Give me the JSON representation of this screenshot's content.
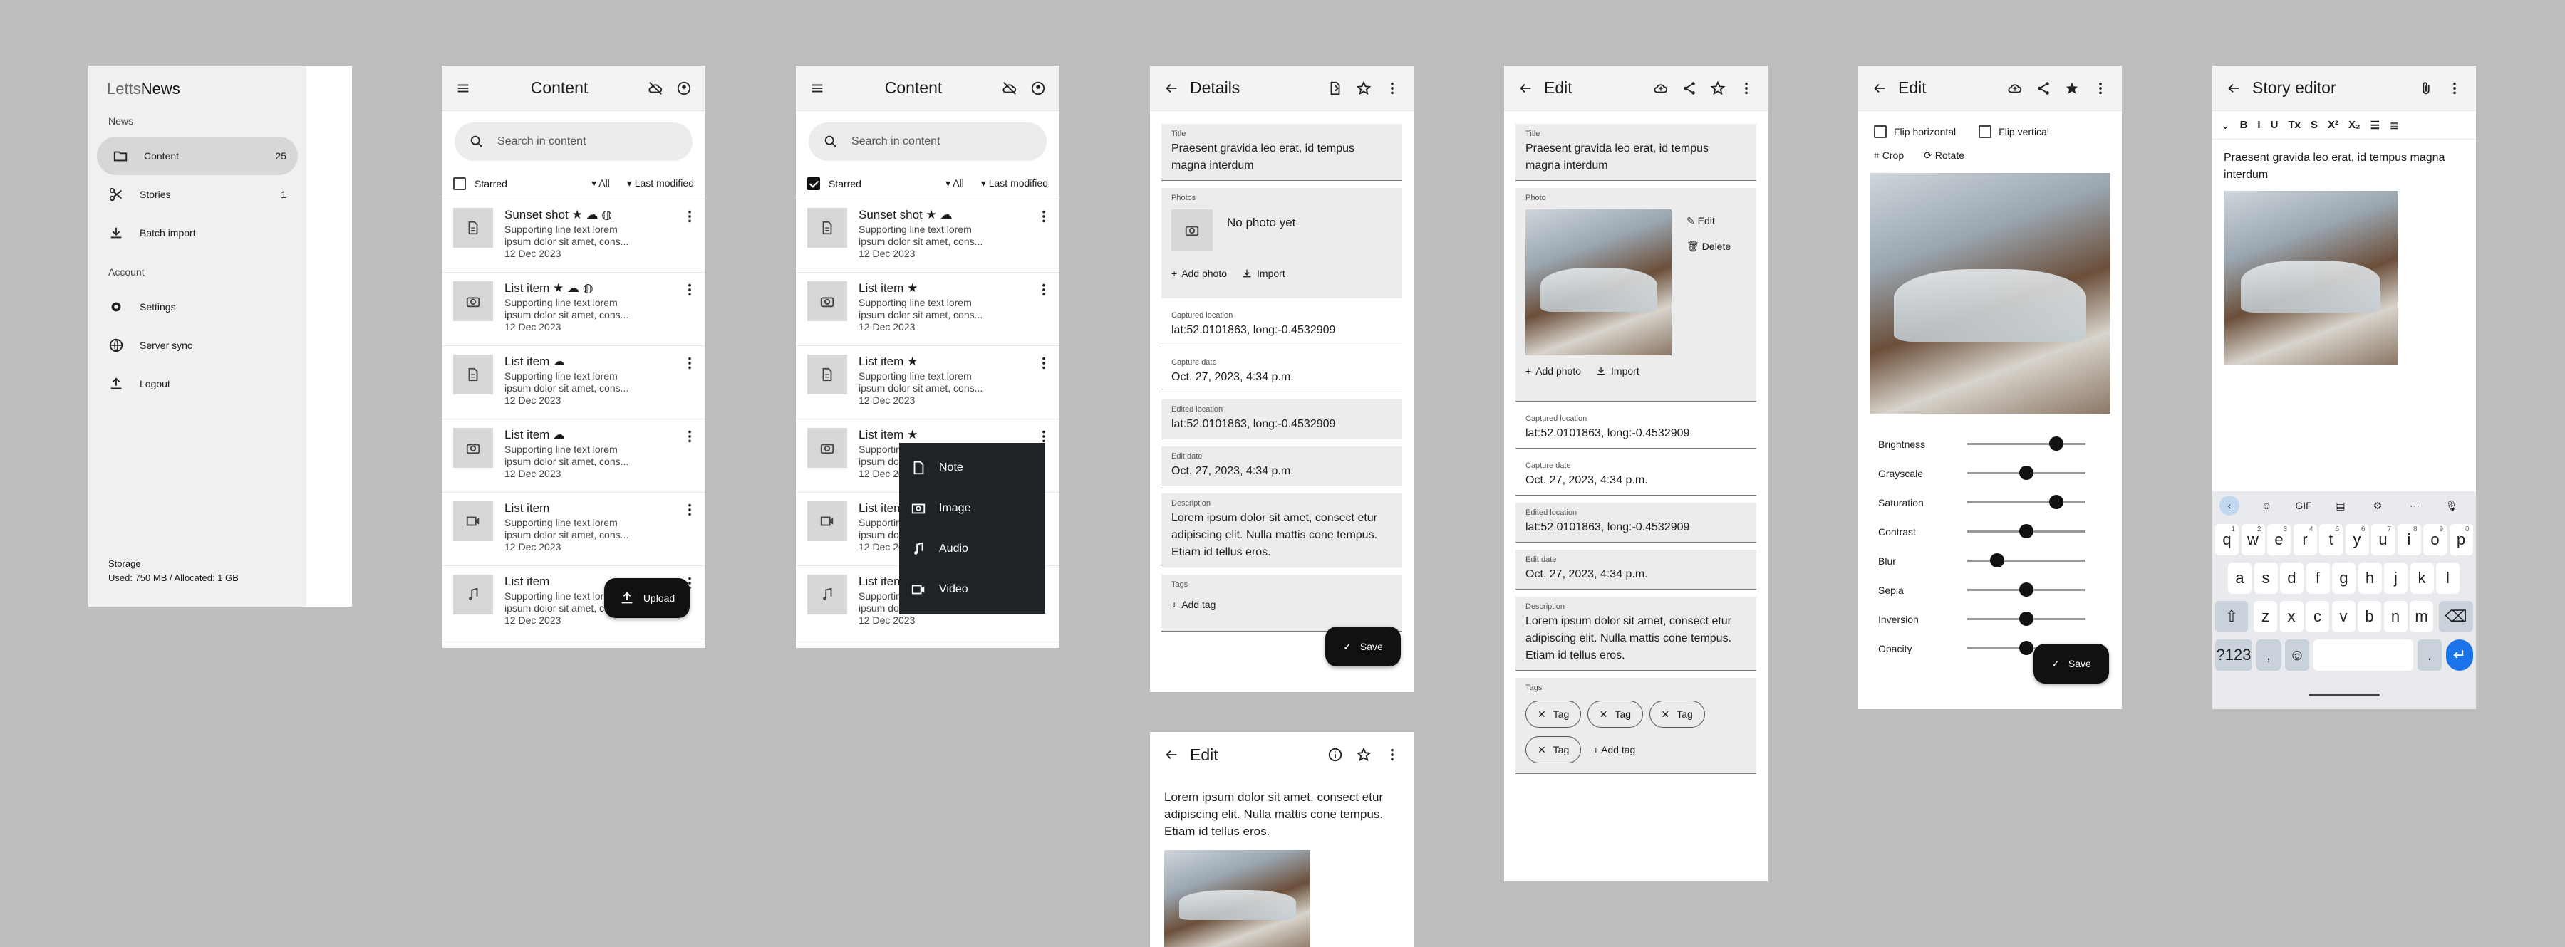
{
  "nav": {
    "brand_a": "Letts",
    "brand_b": "News",
    "section_news": "News",
    "items": [
      {
        "label": "Content",
        "count": "25",
        "icon": "folder-icon"
      },
      {
        "label": "Stories",
        "count": "1",
        "icon": "scissors-icon"
      },
      {
        "label": "Batch import",
        "count": "",
        "icon": "download-icon"
      }
    ],
    "section_account": "Account",
    "account_items": [
      {
        "label": "Settings",
        "icon": "gear-icon"
      },
      {
        "label": "Server sync",
        "icon": "globe-icon"
      },
      {
        "label": "Logout",
        "icon": "logout-icon"
      }
    ],
    "storage_title": "Storage",
    "storage_value": "Used: 750 MB / Allocated: 1 GB"
  },
  "content": {
    "title": "Content",
    "search_placeholder": "Search in content",
    "filter_starred": "Starred",
    "filter_all": "All",
    "filter_sort": "Last modified",
    "upload_label": "Upload",
    "items": [
      {
        "title": "Sunset shot ★ ☁ ◍",
        "l1": "Supporting line text lorem",
        "l2": "ipsum dolor sit amet, cons...",
        "date": "12 Dec 2023",
        "type": "document"
      },
      {
        "title": "List item ★ ☁ ◍",
        "l1": "Supporting line text lorem",
        "l2": "ipsum dolor sit amet, cons...",
        "date": "12 Dec 2023",
        "type": "camera"
      },
      {
        "title": "List item ☁",
        "l1": "Supporting line text lorem",
        "l2": "ipsum dolor sit amet, cons...",
        "date": "12 Dec 2023",
        "type": "document"
      },
      {
        "title": "List item ☁",
        "l1": "Supporting line text lorem",
        "l2": "ipsum dolor sit amet, cons...",
        "date": "12 Dec 2023",
        "type": "camera"
      },
      {
        "title": "List item",
        "l1": "Supporting line text lorem",
        "l2": "ipsum dolor sit amet, cons...",
        "date": "12 Dec 2023",
        "type": "video"
      },
      {
        "title": "List item",
        "l1": "Supporting line text lorem",
        "l2": "ipsum dolor sit amet, cons...",
        "date": "12 Dec 2023",
        "type": "audio"
      }
    ]
  },
  "content2": {
    "items": [
      {
        "title": "Sunset shot ★ ☁"
      },
      {
        "title": "List item ★"
      },
      {
        "title": "List item ★"
      },
      {
        "title": "List item ★"
      },
      {
        "title": "List item"
      },
      {
        "title": "List item"
      }
    ],
    "menu": [
      {
        "label": "Note",
        "icon": "note-icon"
      },
      {
        "label": "Image",
        "icon": "image-icon"
      },
      {
        "label": "Audio",
        "icon": "music-icon"
      },
      {
        "label": "Video",
        "icon": "video-icon"
      }
    ]
  },
  "details": {
    "title": "Details",
    "title_label": "Title",
    "title_value": "Praesent gravida leo erat, id tempus magna interdum",
    "photos_label": "Photos",
    "no_photo": "No photo yet",
    "add_photo": "Add photo",
    "import": "Import",
    "captured_location_label": "Captured location",
    "captured_location": "lat:52.0101863, long:-0.4532909",
    "capture_date_label": "Capture date",
    "capture_date": "Oct. 27, 2023, 4:34 p.m.",
    "edited_location_label": "Edited location",
    "edited_location": "lat:52.0101863, long:-0.4532909",
    "edit_date_label": "Edit date",
    "edit_date": "Oct. 27, 2023, 4:34 p.m.",
    "description_label": "Description",
    "description": "Lorem ipsum dolor sit amet, consect etur adipiscing elit. Nulla mattis cone tempus. Etiam id tellus eros.",
    "tags_label": "Tags",
    "add_tag": "Add tag",
    "save": "Save"
  },
  "edit_small": {
    "title": "Edit",
    "body": "Lorem ipsum dolor sit amet, consect etur adipiscing elit. Nulla mattis cone tempus. Etiam id tellus eros."
  },
  "edit": {
    "title": "Edit",
    "photo_label": "Photo",
    "edit_btn": "Edit",
    "delete_btn": "Delete",
    "tag": "Tag"
  },
  "image_edit": {
    "title": "Edit",
    "flip_h": "Flip horizontal",
    "flip_v": "Flip vertical",
    "crop": "Crop",
    "rotate": "Rotate",
    "sliders": [
      {
        "name": "Brightness",
        "value": 0.75
      },
      {
        "name": "Grayscale",
        "value": 0.5
      },
      {
        "name": "Saturation",
        "value": 0.75
      },
      {
        "name": "Contrast",
        "value": 0.5
      },
      {
        "name": "Blur",
        "value": 0.25
      },
      {
        "name": "Sepia",
        "value": 0.5
      },
      {
        "name": "Inversion",
        "value": 0.5
      },
      {
        "name": "Opacity",
        "value": 0.5
      }
    ],
    "save": "Save"
  },
  "story": {
    "title": "Story editor",
    "text": "Praesent gravida leo erat, id tempus magna interdum",
    "toolbar": [
      "B",
      "I",
      "U",
      "Tx",
      "S",
      "X²",
      "X₂"
    ],
    "kb_row1": [
      "q",
      "w",
      "e",
      "r",
      "t",
      "y",
      "u",
      "i",
      "o",
      "p"
    ],
    "kb_row1_nums": [
      "1",
      "2",
      "3",
      "4",
      "5",
      "6",
      "7",
      "8",
      "9",
      "0"
    ],
    "kb_row2": [
      "a",
      "s",
      "d",
      "f",
      "g",
      "h",
      "j",
      "k",
      "l"
    ],
    "kb_row3": [
      "z",
      "x",
      "c",
      "v",
      "b",
      "n",
      "m"
    ],
    "kb_sym": "?123",
    "kb_comma": ",",
    "kb_period": ".",
    "gif": "GIF"
  }
}
